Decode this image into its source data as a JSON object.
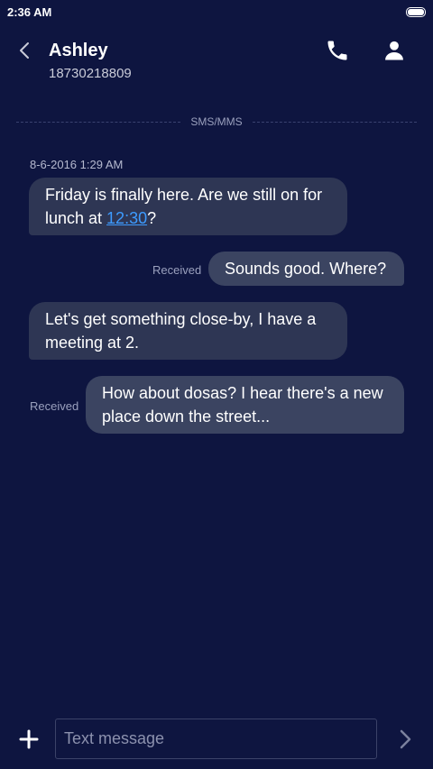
{
  "status_bar": {
    "time": "2:36 AM"
  },
  "header": {
    "contact_name": "Ashley",
    "contact_number": "18730218809",
    "icons": {
      "back": "chevron-left-icon",
      "call": "phone-icon",
      "profile": "person-icon"
    }
  },
  "thread": {
    "channel_label": "SMS/MMS",
    "timestamp": "8-6-2016 1:29 AM",
    "messages": [
      {
        "direction": "incoming",
        "text_before_link": "Friday is finally here. Are we still on for lunch at ",
        "link": "12:30",
        "text_after_link": "?"
      },
      {
        "direction": "outgoing",
        "text": "Sounds good. Where?",
        "status": "Received"
      },
      {
        "direction": "incoming",
        "text": "Let's get something close-by, I have a meeting at 2."
      },
      {
        "direction": "outgoing",
        "text": "How about dosas? I hear there's a new place down the street...",
        "status": "Received"
      }
    ]
  },
  "composer": {
    "placeholder": "Text message",
    "icons": {
      "attach": "plus-icon",
      "send": "send-chevron-icon"
    }
  },
  "colors": {
    "background": "#0e1540",
    "incoming_bubble": "#2e3654",
    "outgoing_bubble": "#3b4461",
    "link": "#3d9bff"
  }
}
